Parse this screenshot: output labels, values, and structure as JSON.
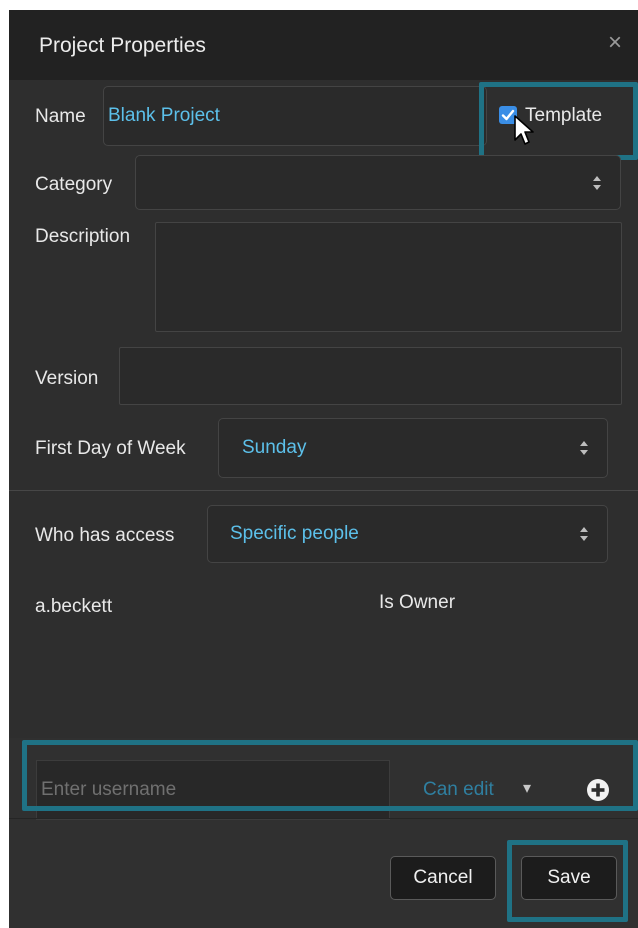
{
  "dialog": {
    "title": "Project Properties",
    "close_glyph": "×"
  },
  "form": {
    "name_label": "Name",
    "name_value": "Blank Project",
    "template_label": "Template",
    "template_checked": true,
    "category_label": "Category",
    "category_value": "",
    "description_label": "Description",
    "description_value": "",
    "version_label": "Version",
    "version_value": "",
    "first_day_label": "First Day of Week",
    "first_day_value": "Sunday"
  },
  "access": {
    "label": "Who has access",
    "value": "Specific people",
    "members": [
      {
        "username": "a.beckett",
        "role": "Is Owner"
      }
    ]
  },
  "add_user": {
    "placeholder": "Enter username",
    "permission": "Can edit",
    "permission_arrow": "▾",
    "add_icon": "plus-circle-icon"
  },
  "footer": {
    "cancel_label": "Cancel",
    "save_label": "Save"
  },
  "colors": {
    "accent_text": "#5cc0ea",
    "highlight_border": "#1f7285",
    "checkbox_blue": "#3a8ee6",
    "background": "#2e2e2e"
  }
}
